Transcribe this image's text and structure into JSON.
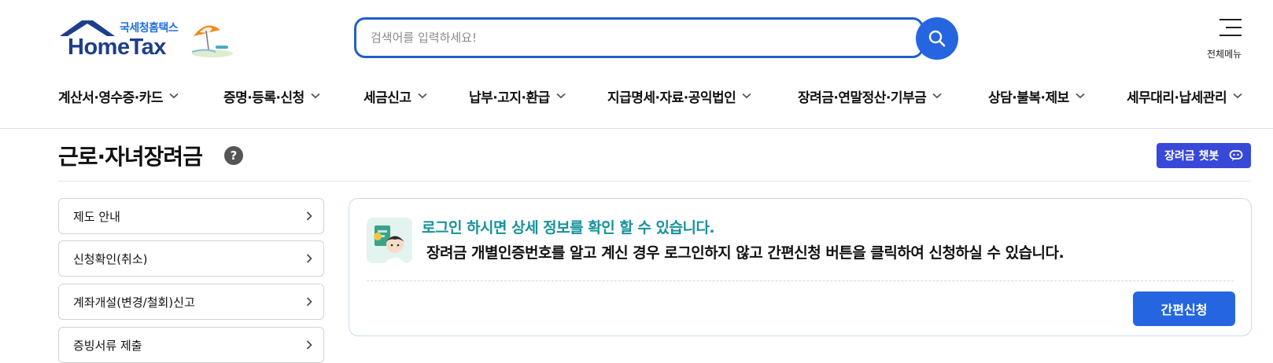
{
  "header": {
    "logo": {
      "sub_text": "국세청홈택스",
      "main_text": "HomeTax"
    },
    "search": {
      "placeholder": "검색어를 입력하세요!",
      "value": ""
    },
    "all_menu_label": "전체메뉴"
  },
  "gnb": {
    "items": [
      {
        "label": "계산서·영수증·카드"
      },
      {
        "label": "증명·등록·신청"
      },
      {
        "label": "세금신고"
      },
      {
        "label": "납부·고지·환급"
      },
      {
        "label": "지급명세·자료·공익법인"
      },
      {
        "label": "장려금·연말정산·기부금"
      },
      {
        "label": "상담·불복·제보"
      },
      {
        "label": "세무대리·납세관리"
      }
    ]
  },
  "page": {
    "title": "근로·자녀장려금",
    "help_label": "?",
    "chatbot_label": "장려금 챗봇"
  },
  "side_menu": {
    "items": [
      {
        "label": "제도 안내"
      },
      {
        "label": "신청확인(취소)"
      },
      {
        "label": "계좌개설(변경/철회)신고"
      },
      {
        "label": "증빙서류 제출"
      }
    ]
  },
  "info": {
    "title": "로그인 하시면 상세 정보를 확인 할 수 있습니다.",
    "description": "장려금 개별인증번호를 알고 계신 경우 로그인하지 않고 간편신청 버튼을 클릭하여 신청하실 수 있습니다.",
    "button_label": "간편신청"
  },
  "colors": {
    "primary_blue": "#2566e0",
    "logo_navy": "#1d3e8c",
    "teal_title": "#15929a",
    "chatbot_purple": "#3848d8"
  }
}
